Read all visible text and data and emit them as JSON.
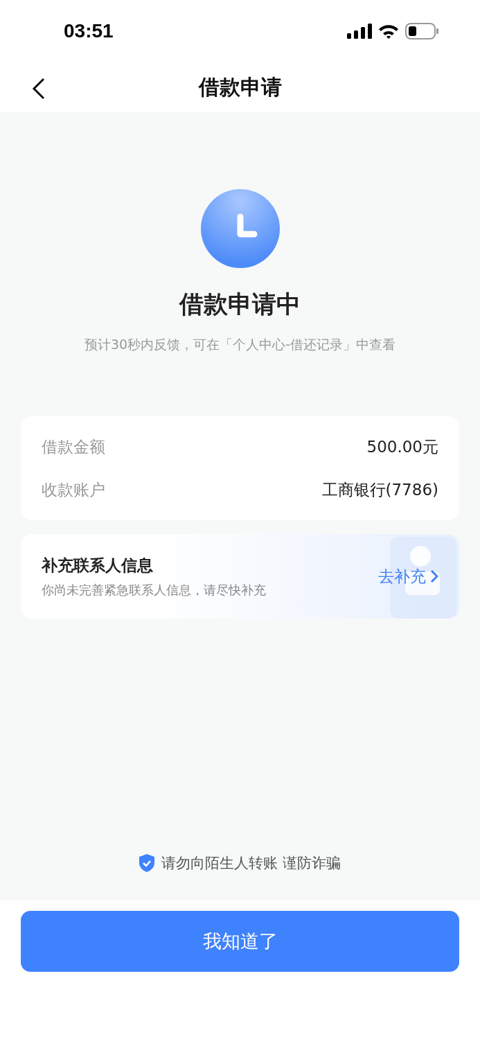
{
  "status_bar": {
    "time": "03:51"
  },
  "nav": {
    "title": "借款申请"
  },
  "status": {
    "title": "借款申请中",
    "subtitle": "预计30秒内反馈，可在「个人中心-借还记录」中查看"
  },
  "details": [
    {
      "label": "借款金额",
      "value": "500.00元"
    },
    {
      "label": "收款账户",
      "value": "工商银行(7786)"
    }
  ],
  "contact_card": {
    "title": "补充联系人信息",
    "description": "你尚未完善紧急联系人信息，请尽快补充",
    "action": "去补充"
  },
  "notice": "请勿向陌生人转账 谨防诈骗",
  "confirm_button": "我知道了"
}
